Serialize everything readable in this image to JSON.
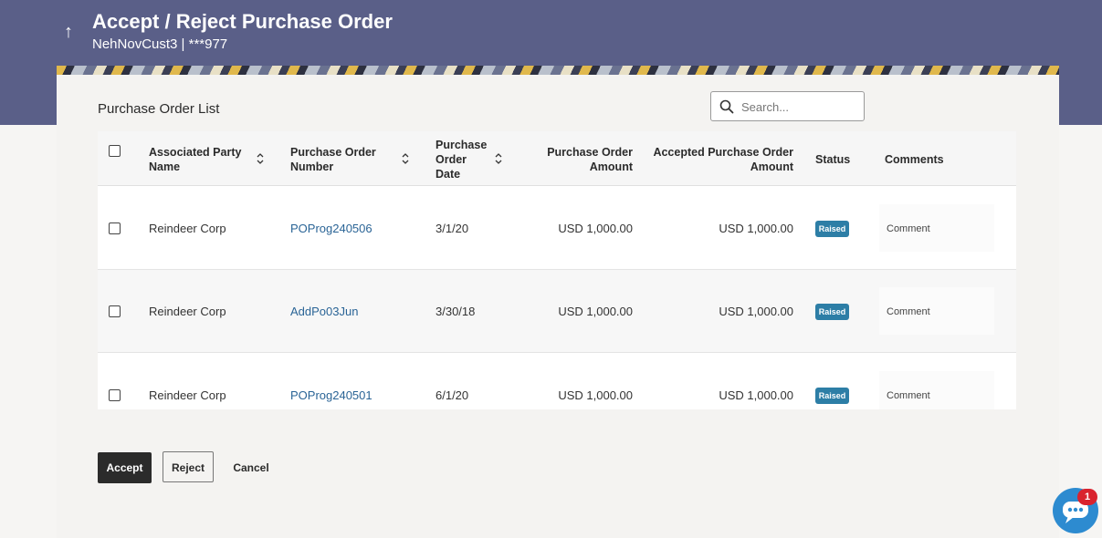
{
  "header": {
    "title": "Accept / Reject Purchase Order",
    "subtitle": "NehNovCust3 | ***977"
  },
  "section": {
    "title": "Purchase Order List"
  },
  "search": {
    "placeholder": "Search..."
  },
  "table": {
    "columns": {
      "party_line1": "Associated Party",
      "party_line2": "Name",
      "po_number_line1": "Purchase Order",
      "po_number_line2": "Number",
      "po_date_line1": "Purchase",
      "po_date_line2": "Order",
      "po_date_line3": "Date",
      "po_amount_line1": "Purchase Order",
      "po_amount_line2": "Amount",
      "accepted_amount_line1": "Accepted Purchase Order",
      "accepted_amount_line2": "Amount",
      "status": "Status",
      "comments": "Comments"
    },
    "rows": [
      {
        "party": "Reindeer Corp",
        "po_number": "POProg240506",
        "date": "3/1/20",
        "amount": "USD 1,000.00",
        "accepted_amount": "USD 1,000.00",
        "status": "Raised",
        "comment": "Comment"
      },
      {
        "party": "Reindeer Corp",
        "po_number": "AddPo03Jun",
        "date": "3/30/18",
        "amount": "USD 1,000.00",
        "accepted_amount": "USD 1,000.00",
        "status": "Raised",
        "comment": "Comment"
      },
      {
        "party": "Reindeer Corp",
        "po_number": "POProg240501",
        "date": "6/1/20",
        "amount": "USD 1,000.00",
        "accepted_amount": "USD 1,000.00",
        "status": "Raised",
        "comment": "Comment"
      }
    ]
  },
  "actions": {
    "accept": "Accept",
    "reject": "Reject",
    "cancel": "Cancel"
  },
  "chat": {
    "badge_count": "1"
  },
  "colors": {
    "header_bg": "#5a5f88",
    "link": "#2a6496",
    "status_badge": "#2d7ea6",
    "primary_button": "#2b2b2b",
    "chat": "#2d8bd0",
    "notification": "#d9232e"
  }
}
